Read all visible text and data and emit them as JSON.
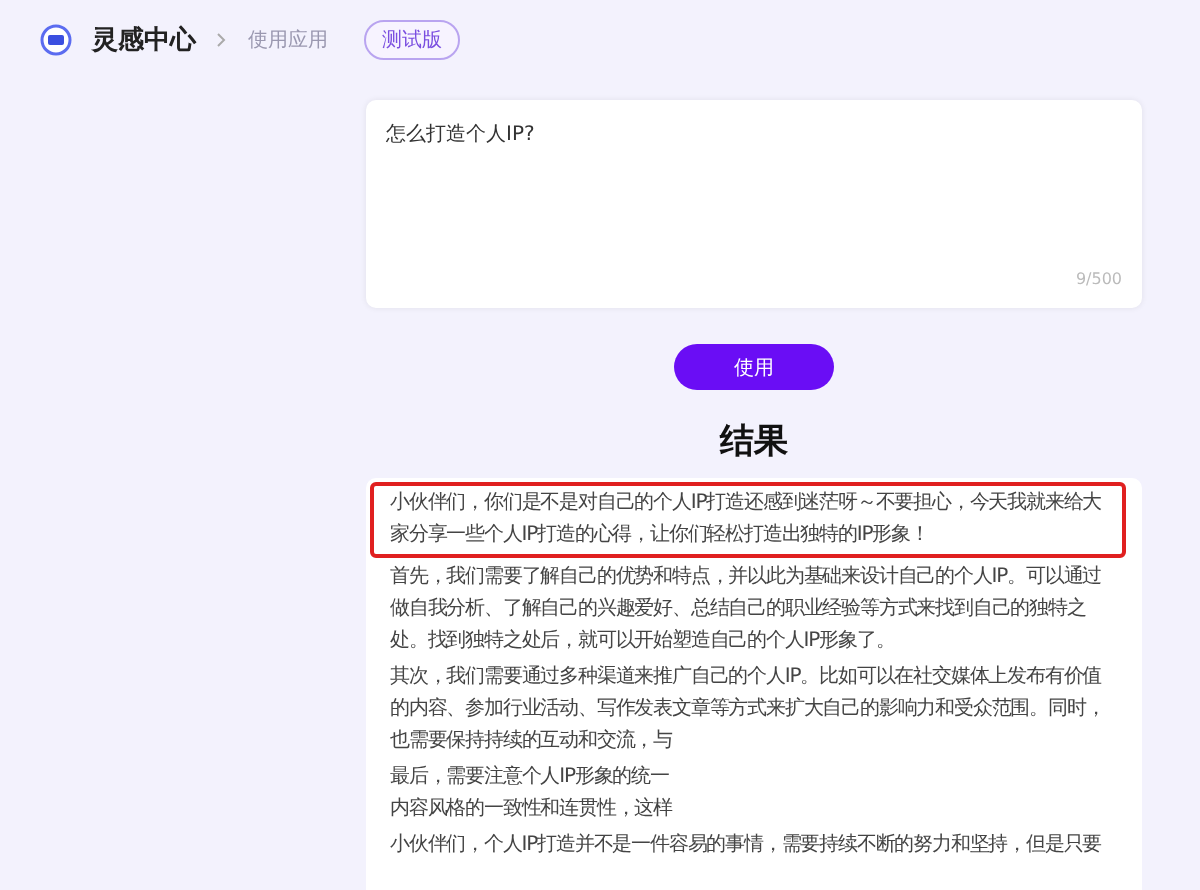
{
  "header": {
    "app_name": "灵感中心",
    "breadcrumb": "使用应用",
    "badge": "测试版"
  },
  "prompt": {
    "value": "怎么打造个人IP?",
    "counter": "9/500"
  },
  "submit_button": "使用",
  "result": {
    "title": "结果",
    "paragraphs": [
      {
        "lines": [
          "小伙伴们，你们是不是对自己的个人IP打造还感到迷茫呀～不要担心，今天我就来给大",
          "家分享一些个人IP打造的心得，让你们轻松打造出独特的IP形象！"
        ],
        "highlighted": true
      },
      {
        "lines": [
          "首先，我们需要了解自己的优势和特点，并以此为基础来设计自己的个人IP。可以通过",
          "做自我分析、了解自己的兴趣爱好、总结自己的职业经验等方式来找到自己的独特之",
          "处。找到独特之处后，就可以开始塑造自己的个人IP形象了。"
        ],
        "highlighted": false
      },
      {
        "lines": [
          "其次，我们需要通过多种渠道来推广自己的个人IP。比如可以在社交媒体上发布有价值",
          "的内容、参加行业活动、写作发表文章等方式来扩大自己的影响力和受众范围。同时，",
          "也需要保持持续的互动和交流，与"
        ],
        "highlighted": false
      },
      {
        "lines": [
          "最后，需要注意个人IP形象的统一",
          "内容风格的一致性和连贯性，这样"
        ],
        "highlighted": false
      },
      {
        "lines": [
          "小伙伴们，个人IP打造并不是一件容易的事情，需要持续不断的努力和坚持，但是只要"
        ],
        "highlighted": false
      }
    ]
  }
}
